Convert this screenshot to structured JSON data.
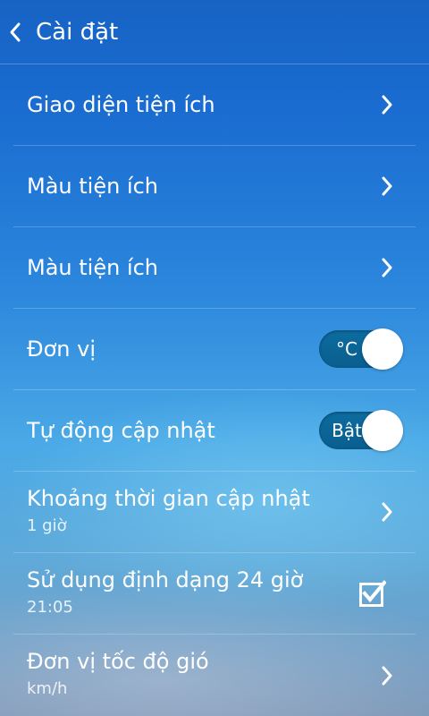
{
  "header": {
    "title": "Cài đặt"
  },
  "settings": {
    "items": [
      {
        "label": "Giao diện tiện ích"
      },
      {
        "label": "Màu tiện ích"
      },
      {
        "label": "Màu tiện ích"
      },
      {
        "label": "Đơn vị",
        "toggle_text": "°C",
        "toggle_on": true
      },
      {
        "label": "Tự động cập nhật",
        "toggle_text": "Bật",
        "toggle_on": true
      },
      {
        "label": "Khoảng thời gian cập nhật",
        "value": "1 giờ"
      },
      {
        "label": "Sử dụng định dạng 24 giờ",
        "value": "21:05",
        "checked": true
      },
      {
        "label": "Đơn vị tốc độ gió",
        "value": "km/h"
      }
    ]
  },
  "icons": {
    "back": "chevron-left-icon",
    "row_arrow": "chevron-right-icon",
    "checkbox": "checkbox-checked-icon"
  },
  "colors": {
    "toggle_track": "#0a5e8e",
    "text": "#ffffff"
  }
}
